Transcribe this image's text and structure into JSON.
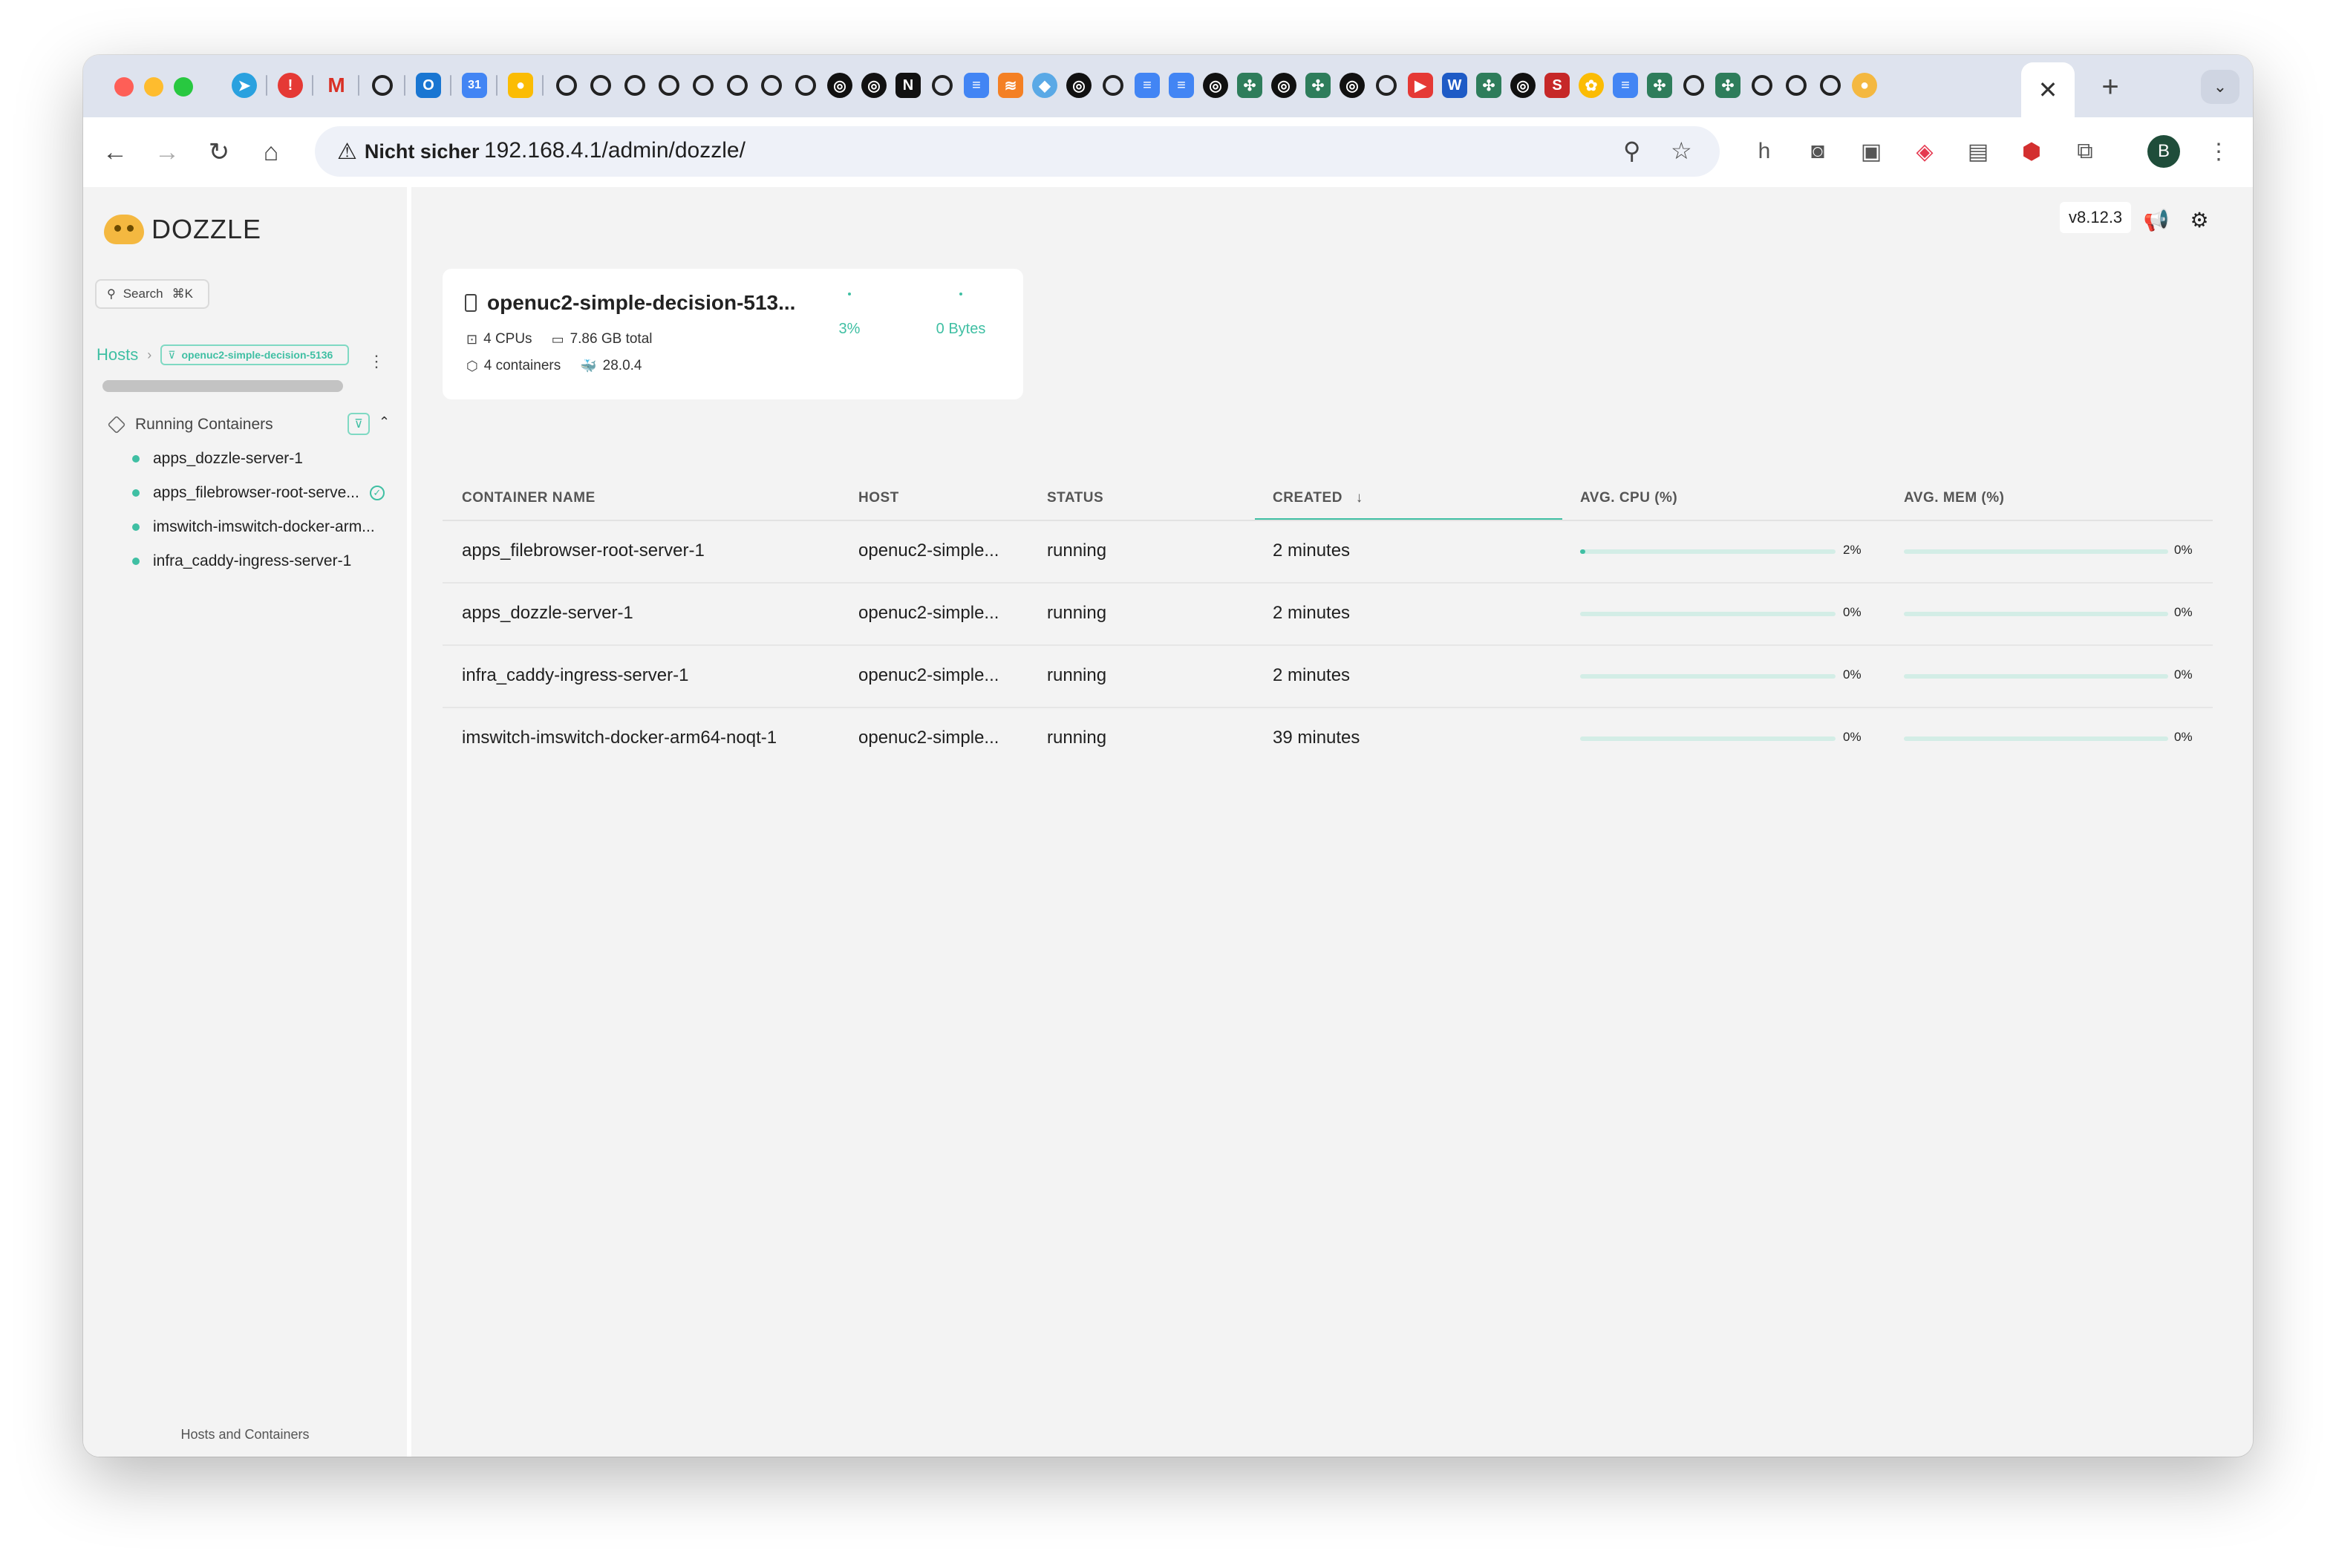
{
  "browser": {
    "address": {
      "security_label": "Nicht sicher",
      "url": "192.168.4.1/admin/dozzle/"
    },
    "profile_initial": "B",
    "tab_close": "✕",
    "new_tab": "+"
  },
  "app": {
    "name": "DOZZLE",
    "version": "v8.12.3"
  },
  "sidebar": {
    "search_label": "Search",
    "search_shortcut": "⌘K",
    "breadcrumb": {
      "hosts": "Hosts",
      "host": "openuc2-simple-decision-5136"
    },
    "section_label": "Running Containers",
    "containers": [
      {
        "label": "apps_dozzle-server-1",
        "pinned": false
      },
      {
        "label": "apps_filebrowser-root-serve...",
        "pinned": true
      },
      {
        "label": "imswitch-imswitch-docker-arm...",
        "pinned": false
      },
      {
        "label": "infra_caddy-ingress-server-1",
        "pinned": false
      }
    ],
    "footer": "Hosts and Containers"
  },
  "host_card": {
    "name": "openuc2-simple-decision-513...",
    "cpus": "4 CPUs",
    "memory": "7.86 GB total",
    "containers": "4 containers",
    "docker_version": "28.0.4",
    "cpu_usage": "3%",
    "mem_usage": "0 Bytes"
  },
  "table": {
    "headers": {
      "name": "CONTAINER NAME",
      "host": "HOST",
      "status": "STATUS",
      "created": "CREATED",
      "cpu": "AVG. CPU (%)",
      "mem": "AVG. MEM (%)"
    },
    "rows": [
      {
        "name": "apps_filebrowser-root-server-1",
        "host": "openuc2-simple...",
        "status": "running",
        "created": "2 minutes",
        "cpu": "2%",
        "cpu_value": 2,
        "mem": "0%",
        "mem_value": 0
      },
      {
        "name": "apps_dozzle-server-1",
        "host": "openuc2-simple...",
        "status": "running",
        "created": "2 minutes",
        "cpu": "0%",
        "cpu_value": 0,
        "mem": "0%",
        "mem_value": 0
      },
      {
        "name": "infra_caddy-ingress-server-1",
        "host": "openuc2-simple...",
        "status": "running",
        "created": "2 minutes",
        "cpu": "0%",
        "cpu_value": 0,
        "mem": "0%",
        "mem_value": 0
      },
      {
        "name": "imswitch-imswitch-docker-arm64-noqt-1",
        "host": "openuc2-simple...",
        "status": "running",
        "created": "39 minutes",
        "cpu": "0%",
        "cpu_value": 0,
        "mem": "0%",
        "mem_value": 0
      }
    ]
  },
  "colors": {
    "accent": "#3fbfa3",
    "brand": "#f4b840"
  }
}
